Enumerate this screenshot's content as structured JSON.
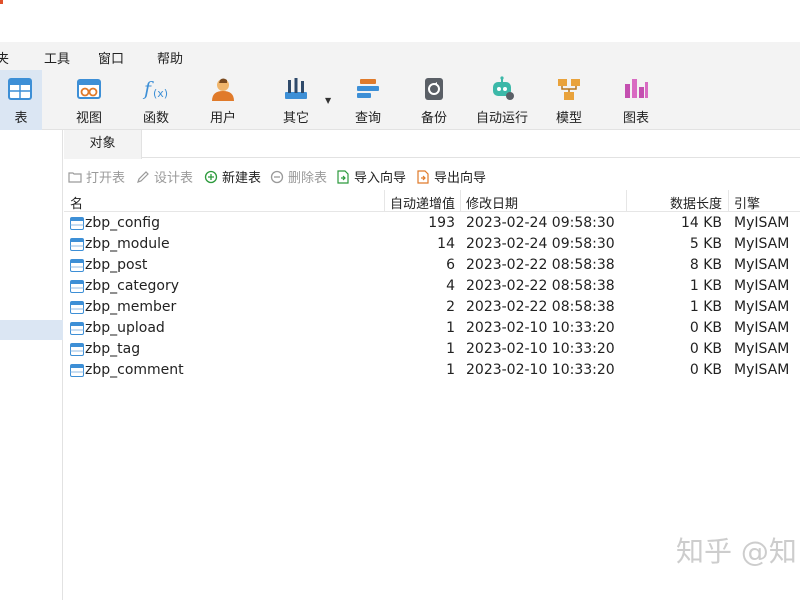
{
  "menubar": {
    "items": [
      "夹",
      "工具",
      "窗口",
      "帮助"
    ]
  },
  "toolbar": {
    "buttons": [
      {
        "label": "表",
        "icon": "table-icon"
      },
      {
        "label": "视图",
        "icon": "view-icon"
      },
      {
        "label": "函数",
        "icon": "function-icon"
      },
      {
        "label": "用户",
        "icon": "user-icon"
      },
      {
        "label": "其它",
        "icon": "tools-icon"
      },
      {
        "label": "查询",
        "icon": "query-icon"
      },
      {
        "label": "备份",
        "icon": "backup-icon"
      },
      {
        "label": "自动运行",
        "icon": "robot-icon"
      },
      {
        "label": "模型",
        "icon": "model-icon"
      },
      {
        "label": "图表",
        "icon": "chart-icon"
      }
    ]
  },
  "tabs": {
    "object_tab": "对象"
  },
  "actions": {
    "open_table": "打开表",
    "design_table": "设计表",
    "new_table": "新建表",
    "delete_table": "删除表",
    "import_wizard": "导入向导",
    "export_wizard": "导出向导"
  },
  "table": {
    "columns": [
      "名",
      "自动递增值",
      "修改日期",
      "数据长度",
      "引擎"
    ],
    "rows": [
      {
        "name": "zbp_config",
        "auto_inc": "193",
        "modified": "2023-02-24 09:58:30",
        "size": "14 KB",
        "engine": "MyISAM"
      },
      {
        "name": "zbp_module",
        "auto_inc": "14",
        "modified": "2023-02-24 09:58:30",
        "size": "5 KB",
        "engine": "MyISAM"
      },
      {
        "name": "zbp_post",
        "auto_inc": "6",
        "modified": "2023-02-22 08:58:38",
        "size": "8 KB",
        "engine": "MyISAM"
      },
      {
        "name": "zbp_category",
        "auto_inc": "4",
        "modified": "2023-02-22 08:58:38",
        "size": "1 KB",
        "engine": "MyISAM"
      },
      {
        "name": "zbp_member",
        "auto_inc": "2",
        "modified": "2023-02-22 08:58:38",
        "size": "1 KB",
        "engine": "MyISAM"
      },
      {
        "name": "zbp_upload",
        "auto_inc": "1",
        "modified": "2023-02-10 10:33:20",
        "size": "0 KB",
        "engine": "MyISAM"
      },
      {
        "name": "zbp_tag",
        "auto_inc": "1",
        "modified": "2023-02-10 10:33:20",
        "size": "0 KB",
        "engine": "MyISAM"
      },
      {
        "name": "zbp_comment",
        "auto_inc": "1",
        "modified": "2023-02-10 10:33:20",
        "size": "0 KB",
        "engine": "MyISAM"
      }
    ]
  },
  "watermark": "知乎 @知",
  "colors": {
    "selected_bg": "#dbe6f3",
    "toolbar_bg": "#f3f3f3",
    "table_icon_blue": "#3d8fd6",
    "new_green": "#2c9a3c"
  }
}
